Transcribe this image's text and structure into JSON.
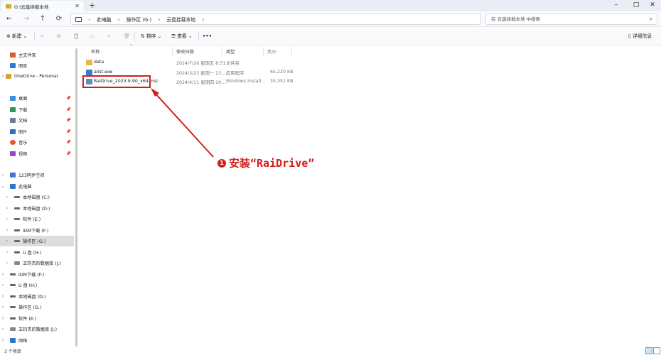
{
  "window": {
    "tab_title": "G:\\云盘挂载本地",
    "new_tab": "+",
    "minimize": "–",
    "maximize": "□",
    "close": "✕"
  },
  "nav": {
    "back": "←",
    "forward": "→",
    "up": "↑",
    "refresh": "⟳",
    "breadcrumb": [
      "此电脑",
      "操作区 (G:)",
      "云盘挂载本地"
    ],
    "search_placeholder": "在 云盘挂载本地 中搜索"
  },
  "toolbar": {
    "new_label": "新建",
    "sort_label": "排序",
    "view_label": "查看",
    "more": "•••",
    "details_label": "详细信息"
  },
  "sidebar": {
    "quick": [
      {
        "label": "主文件夹",
        "icon": "home-icon"
      },
      {
        "label": "图库",
        "icon": "gallery-icon"
      },
      {
        "label": "OneDrive - Personal",
        "icon": "cloud-icon"
      }
    ],
    "pinned": [
      {
        "label": "桌面",
        "icon": "desktop-icon"
      },
      {
        "label": "下载",
        "icon": "download-icon"
      },
      {
        "label": "文档",
        "icon": "document-icon"
      },
      {
        "label": "图片",
        "icon": "picture-icon"
      },
      {
        "label": "音乐",
        "icon": "music-icon"
      },
      {
        "label": "视频",
        "icon": "video-icon"
      }
    ],
    "tree": [
      {
        "label": "123同步空间",
        "level": 0
      },
      {
        "label": "此电脑",
        "level": 0,
        "expanded": true
      },
      {
        "label": "本地磁盘 (C:)",
        "level": 1
      },
      {
        "label": "本地磁盘 (D:)",
        "level": 1
      },
      {
        "label": "软件 (E:)",
        "level": 1
      },
      {
        "label": "IDM下载 (F:)",
        "level": 1
      },
      {
        "label": "操作区 (G:)",
        "level": 1,
        "selected": true
      },
      {
        "label": "U 盘 (H:)",
        "level": 1
      },
      {
        "label": "王钧杰的数据库 (J:)",
        "level": 1
      },
      {
        "label": "IDM下载 (F:)",
        "level": 0
      },
      {
        "label": "U 盘 (H:)",
        "level": 0
      },
      {
        "label": "本地磁盘 (D:)",
        "level": 0
      },
      {
        "label": "操作区 (G:)",
        "level": 0
      },
      {
        "label": "软件 (E:)",
        "level": 0
      },
      {
        "label": "王钧杰的数据库 (J:)",
        "level": 0
      },
      {
        "label": "网络",
        "level": 0
      }
    ]
  },
  "columns": {
    "name": "名称",
    "date": "修改日期",
    "type": "类型",
    "size": "大小"
  },
  "files": [
    {
      "name": "data",
      "date": "2024/7/26 星期五 8:51",
      "type": "文件夹",
      "size": "",
      "icon": "folder-icon"
    },
    {
      "name": "alist.exe",
      "date": "2024/3/25 星期一 23:...",
      "type": "应用程序",
      "size": "65,220 KB",
      "icon": "exe-icon"
    },
    {
      "name": "RaiDrive_2023.9.90_x64.msi",
      "date": "2024/4/11 星期四 20:...",
      "type": "Windows Install...",
      "size": "35,351 KB",
      "icon": "msi-icon"
    }
  ],
  "annotation": {
    "number": "1",
    "text": "安装“RaiDrive”",
    "color": "#d31d1d"
  },
  "status": {
    "count": "3 个项目"
  }
}
